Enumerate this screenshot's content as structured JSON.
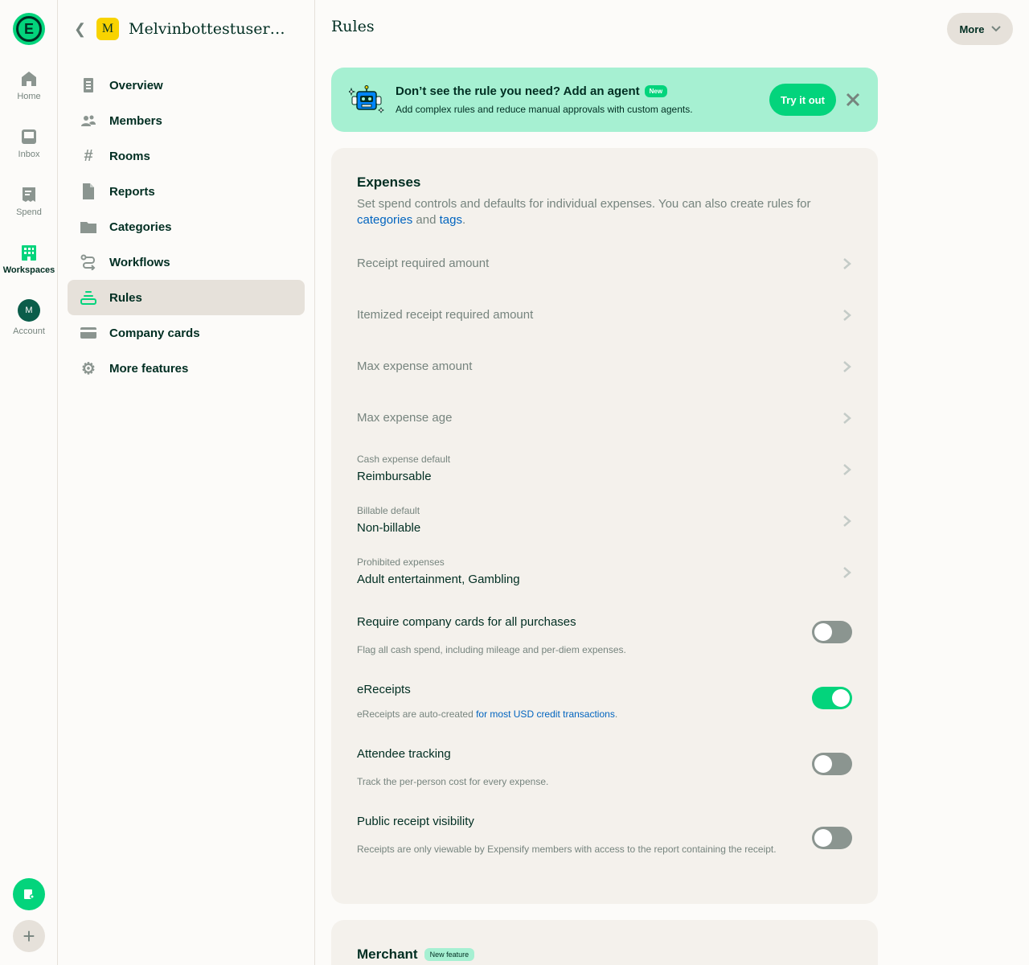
{
  "rail": {
    "items": [
      {
        "label": "Home",
        "icon": "home-icon"
      },
      {
        "label": "Inbox",
        "icon": "inbox-icon"
      },
      {
        "label": "Spend",
        "icon": "receipt-icon"
      },
      {
        "label": "Workspaces",
        "icon": "building-icon",
        "active": true
      },
      {
        "label": "Account",
        "icon": "avatar",
        "avatar_letter": "M"
      }
    ]
  },
  "workspace": {
    "avatar_letter": "M",
    "name": "Melvinbottestuser+3…"
  },
  "sidebar": {
    "items": [
      {
        "label": "Overview",
        "icon": "document-icon"
      },
      {
        "label": "Members",
        "icon": "users-icon"
      },
      {
        "label": "Rooms",
        "icon": "hashtag-icon"
      },
      {
        "label": "Reports",
        "icon": "file-icon"
      },
      {
        "label": "Categories",
        "icon": "folder-icon"
      },
      {
        "label": "Workflows",
        "icon": "workflow-icon"
      },
      {
        "label": "Rules",
        "icon": "rules-icon",
        "active": true
      },
      {
        "label": "Company cards",
        "icon": "card-icon"
      },
      {
        "label": "More features",
        "icon": "gear-icon"
      }
    ]
  },
  "header": {
    "title": "Rules",
    "more_label": "More"
  },
  "banner": {
    "title": "Don’t see the rule you need? Add an agent",
    "badge": "New",
    "subtitle": "Add complex rules and reduce manual approvals with custom agents.",
    "button": "Try it out"
  },
  "expenses": {
    "title": "Expenses",
    "desc_prefix": "Set spend controls and defaults for individual expenses. You can also create rules for ",
    "link_categories": "categories",
    "desc_and": " and ",
    "link_tags": "tags",
    "desc_suffix": ".",
    "rows": [
      {
        "label": "Receipt required amount"
      },
      {
        "label": "Itemized receipt required amount"
      },
      {
        "label": "Max expense amount"
      },
      {
        "label": "Max expense age"
      },
      {
        "label": "Cash expense default",
        "value": "Reimbursable"
      },
      {
        "label": "Billable default",
        "value": "Non-billable"
      },
      {
        "label": "Prohibited expenses",
        "value": "Adult entertainment, Gambling"
      }
    ],
    "toggles": [
      {
        "title": "Require company cards for all purchases",
        "desc": "Flag all cash spend, including mileage and per-diem expenses.",
        "on": false
      },
      {
        "title": "eReceipts",
        "desc_prefix": "eReceipts are auto-created ",
        "desc_link": "for most USD credit transactions",
        "desc_suffix": ".",
        "on": true
      },
      {
        "title": "Attendee tracking",
        "desc": "Track the per-person cost for every expense.",
        "on": false
      },
      {
        "title": "Public receipt visibility",
        "desc": "Receipts are only viewable by Expensify members with access to the report containing the receipt.",
        "on": false
      }
    ]
  },
  "merchant": {
    "title": "Merchant",
    "badge": "New feature"
  },
  "colors": {
    "accent": "#03d47c",
    "banner_bg": "#a6f0d2",
    "text": "#002e22",
    "muted": "#76847e",
    "link": "#0164bf"
  }
}
